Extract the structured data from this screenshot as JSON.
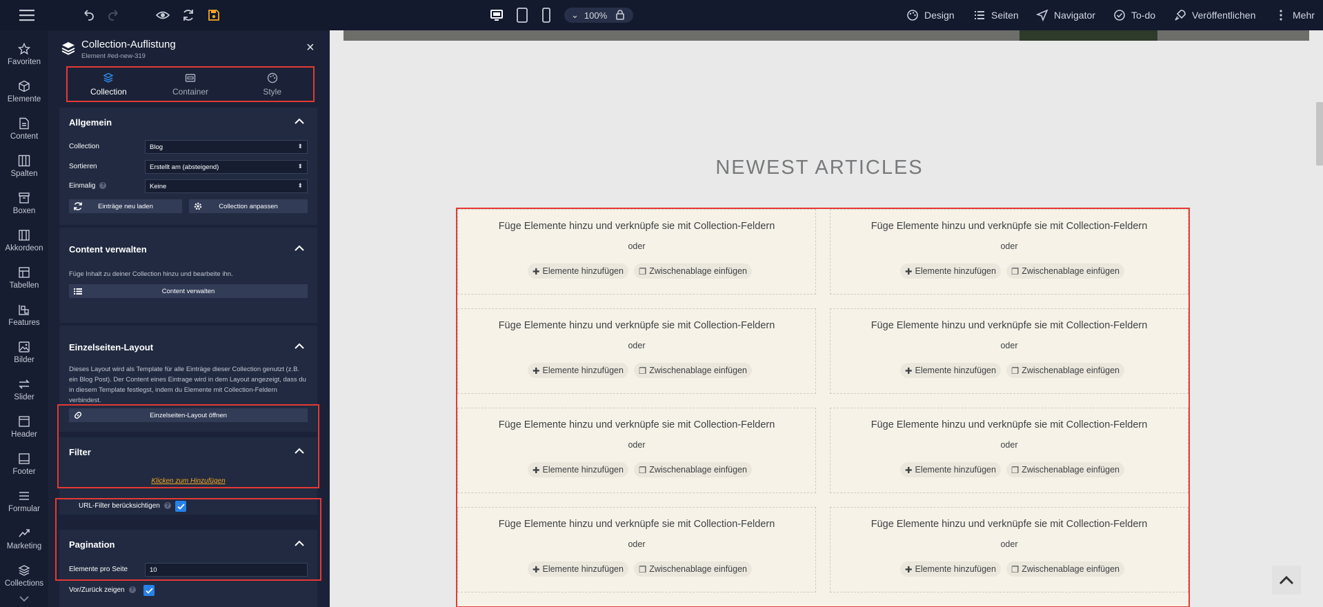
{
  "topbar": {
    "zoom": "100%",
    "nav": [
      {
        "label": "Design",
        "icon": "palette-icon"
      },
      {
        "label": "Seiten",
        "icon": "list-icon"
      },
      {
        "label": "Navigator",
        "icon": "navigation-icon"
      },
      {
        "label": "To-do",
        "icon": "check-circle-icon"
      },
      {
        "label": "Veröffentlichen",
        "icon": "rocket-icon"
      },
      {
        "label": "Mehr",
        "icon": "more-vertical-icon"
      }
    ],
    "accent": "#f5a623"
  },
  "sidebar": {
    "items": [
      {
        "label": "Favoriten",
        "icon": "star-icon"
      },
      {
        "label": "Elemente",
        "icon": "cube-icon"
      },
      {
        "label": "Content",
        "icon": "document-icon"
      },
      {
        "label": "Spalten",
        "icon": "columns-icon"
      },
      {
        "label": "Boxen",
        "icon": "box-icon"
      },
      {
        "label": "Akkordeon",
        "icon": "accordion-icon"
      },
      {
        "label": "Tabellen",
        "icon": "table-icon"
      },
      {
        "label": "Features",
        "icon": "features-icon"
      },
      {
        "label": "Bilder",
        "icon": "image-icon"
      },
      {
        "label": "Slider",
        "icon": "slider-icon"
      },
      {
        "label": "Header",
        "icon": "header-icon"
      },
      {
        "label": "Footer",
        "icon": "footer-icon"
      },
      {
        "label": "Formular",
        "icon": "form-icon"
      },
      {
        "label": "Marketing",
        "icon": "trend-icon"
      },
      {
        "label": "Collections",
        "icon": "layers-icon"
      }
    ]
  },
  "panel": {
    "title": "Collection-Auflistung",
    "subtitle": "Element #ed-new-319",
    "tabs": [
      {
        "label": "Collection",
        "active": true
      },
      {
        "label": "Container",
        "active": false
      },
      {
        "label": "Style",
        "active": false
      }
    ],
    "allgemein": {
      "title": "Allgemein",
      "collection_label": "Collection",
      "collection_value": "Blog",
      "sort_label": "Sortieren",
      "sort_value": "Erstellt am (absteigend)",
      "once_label": "Einmalig",
      "once_value": "Keine",
      "reload_button": "Einträge neu laden",
      "adjust_button": "Collection anpassen"
    },
    "content": {
      "title": "Content verwalten",
      "desc": "Füge Inhalt zu deiner Collection hinzu und bearbeite ihn.",
      "button": "Content verwalten"
    },
    "layout": {
      "title": "Einzelseiten-Layout",
      "desc": "Dieses Layout wird als Template für alle Einträge dieser Collection genutzt (z.B. ein Blog Post). Der Content eines Eintrage wird in dem Layout angezeigt, dass du in diesem Template festlegst, indem du Elemente mit Collection-Feldern verbindest.",
      "button": "Einzelseiten-Layout öffnen"
    },
    "filter": {
      "title": "Filter",
      "add_link": "Klicken zum Hinzufügen",
      "url_label": "URL-Filter berücksichtigen",
      "url_checked": true
    },
    "pagination": {
      "title": "Pagination",
      "per_page_label": "Elemente pro Seite",
      "per_page_value": "10",
      "prevnext_label": "Vor/Zurück zeigen",
      "prevnext_checked": true
    }
  },
  "canvas": {
    "headline": "NEWEST ARTICLES",
    "cell": {
      "title": "Füge Elemente hinzu und verknüpfe sie mit Collection-Feldern",
      "or": "oder",
      "add": "Elemente hinzufügen",
      "paste": "Zwischenablage einfügen"
    }
  }
}
